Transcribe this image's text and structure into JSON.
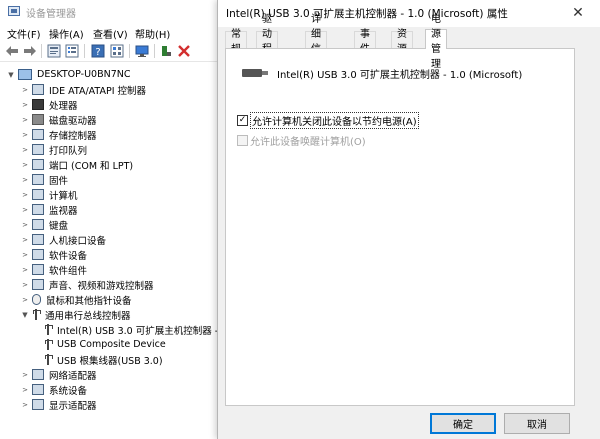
{
  "device_manager": {
    "title": "设备管理器",
    "menu": [
      "文件(F)",
      "操作(A)",
      "查看(V)",
      "帮助(H)"
    ],
    "toolbar_icons": [
      "back-icon",
      "forward-icon",
      "properties-icon",
      "list-icon",
      "help-icon",
      "grid-icon",
      "monitor-icon",
      "update-driver-icon",
      "uninstall-icon"
    ],
    "tree": {
      "root": "DESKTOP-U0BN7NC",
      "categories": [
        "IDE ATA/ATAPI 控制器",
        "处理器",
        "磁盘驱动器",
        "存储控制器",
        "打印队列",
        "端口 (COM 和 LPT)",
        "固件",
        "计算机",
        "监视器",
        "键盘",
        "人机接口设备",
        "软件设备",
        "软件组件",
        "声音、视频和游戏控制器",
        "鼠标和其他指针设备",
        "通用串行总线控制器"
      ],
      "usb_children": [
        "Intel(R) USB 3.0 可扩展主机控制器 -",
        "USB Composite Device",
        "USB 根集线器(USB 3.0)"
      ],
      "trailing_categories": [
        "网络适配器",
        "系统设备",
        "显示适配器"
      ]
    }
  },
  "dialog": {
    "title": "Intel(R) USB 3.0 可扩展主机控制器 - 1.0 (Microsoft) 属性",
    "close_glyph": "✕",
    "tabs": [
      "常规",
      "驱动程序",
      "详细信息",
      "事件",
      "资源",
      "电源管理"
    ],
    "active_tab": "电源管理",
    "device_name": "Intel(R) USB 3.0 可扩展主机控制器 - 1.0 (Microsoft)",
    "options": [
      {
        "label": "允许计算机关闭此设备以节约电源(A)",
        "checked": true,
        "enabled": true
      },
      {
        "label": "允许此设备唤醒计算机(O)",
        "checked": false,
        "enabled": false
      }
    ],
    "ok_label": "确定",
    "cancel_label": "取消"
  }
}
